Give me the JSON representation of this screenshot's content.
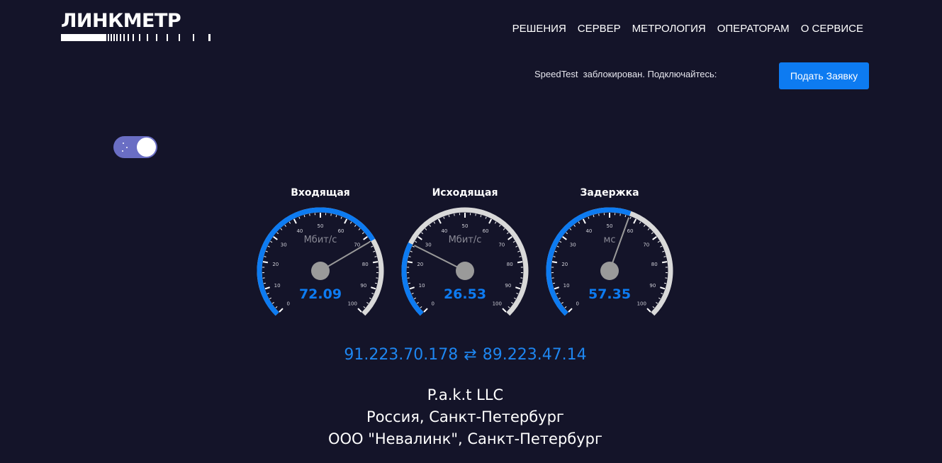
{
  "brand": {
    "name": "ЛИНКМЕТР"
  },
  "nav": {
    "items": [
      "РЕШЕНИЯ",
      "СЕРВЕР",
      "МЕТРОЛОГИЯ",
      "ОПЕРАТОРАМ",
      "О СЕРВИСЕ"
    ]
  },
  "notice": {
    "text": "SpeedTest  заблокирован. Подключайтесь:"
  },
  "cta": {
    "label": "Подать Заявку"
  },
  "theme_toggle": {
    "state": "on"
  },
  "colors": {
    "background": "#141429",
    "accent": "#0d7bf1",
    "gauge_track": "#d9d9d9",
    "needle": "#9a9a9a"
  },
  "gauges": [
    {
      "title": "Входящая",
      "unit": "Мбит/с",
      "value": "72.09",
      "fill": 0.7209,
      "ticks": [
        "0",
        "10",
        "20",
        "30",
        "40",
        "50",
        "60",
        "70",
        "80",
        "90",
        "100"
      ]
    },
    {
      "title": "Исходящая",
      "unit": "Мбит/с",
      "value": "26.53",
      "fill": 0.2653,
      "ticks": [
        "0",
        "10",
        "20",
        "30",
        "40",
        "50",
        "60",
        "70",
        "80",
        "90",
        "100"
      ]
    },
    {
      "title": "Задержка",
      "unit": "мс",
      "value": "57.35",
      "fill": 0.5735,
      "ticks": [
        "0",
        "10",
        "20",
        "30",
        "40",
        "50",
        "60",
        "70",
        "80",
        "90",
        "100"
      ]
    }
  ],
  "connection": {
    "client_ip": "91.223.70.178",
    "arrow": "⇄",
    "server_ip": "89.223.47.14"
  },
  "provider": {
    "name": "P.a.k.t LLC",
    "location": "Россия, Санкт-Петербург",
    "server": "ООО \"Невалинк\", Санкт-Петербург"
  }
}
